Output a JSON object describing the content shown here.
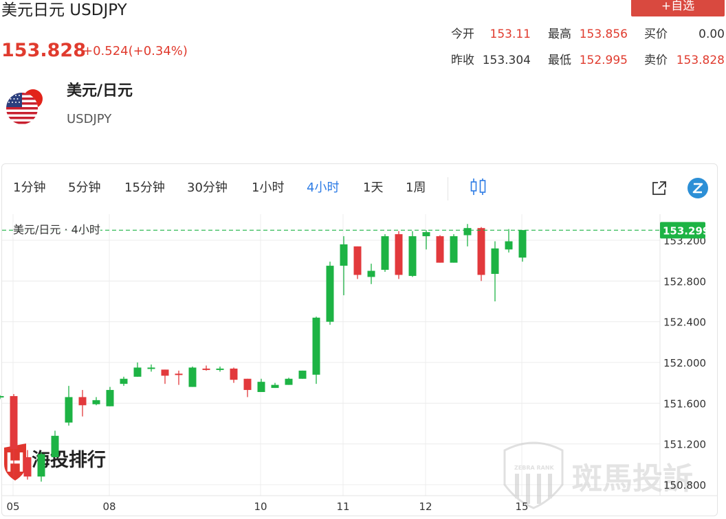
{
  "header": {
    "title": "美元日元 USDJPY",
    "add_button": "+自选",
    "price": "153.828",
    "change": "+0.524(+0.34%)"
  },
  "quote": {
    "open_label": "今开",
    "open": "153.11",
    "high_label": "最高",
    "high": "153.856",
    "bid_label": "买价",
    "bid": "0.00",
    "prev_label": "昨收",
    "prev": "153.304",
    "low_label": "最低",
    "low": "152.995",
    "ask_label": "卖价",
    "ask": "153.828"
  },
  "instrument": {
    "name": "美元/日元",
    "code": "USDJPY",
    "flag_icon": "us-flag-icon"
  },
  "periods": [
    "1分钟",
    "5分钟",
    "15分钟",
    "30分钟",
    "1小时",
    "4小时",
    "1天",
    "1周"
  ],
  "active_period": "4小时",
  "colors": {
    "up": "#1db344",
    "down": "#e2393c",
    "accent": "#2c7be5",
    "last_price": "#1db344",
    "button": "#d9493f"
  },
  "watermarks": {
    "left": "海投排行",
    "right": "斑馬投訴",
    "right_badge": "ZEBRA RANK"
  },
  "chart_data": {
    "type": "candlestick",
    "legend": "美元/日元 · 4小时",
    "last_price": "153.299",
    "y_ticks": [
      "153.200",
      "152.800",
      "152.400",
      "152.000",
      "151.600",
      "151.200",
      "150.800"
    ],
    "x_ticks": [
      "05",
      "08",
      "10",
      "11",
      "12",
      "15"
    ],
    "ylim": [
      150.73,
      153.53
    ],
    "candles": [
      {
        "o": 151.66,
        "h": 151.68,
        "l": 151.64,
        "c": 151.67
      },
      {
        "o": 151.67,
        "h": 151.69,
        "l": 150.88,
        "c": 151.15
      },
      {
        "o": 151.07,
        "h": 151.14,
        "l": 150.85,
        "c": 150.88
      },
      {
        "o": 150.88,
        "h": 151.12,
        "l": 150.83,
        "c": 151.1
      },
      {
        "o": 151.07,
        "h": 151.33,
        "l": 151.07,
        "c": 151.28
      },
      {
        "o": 151.41,
        "h": 151.77,
        "l": 151.38,
        "c": 151.66
      },
      {
        "o": 151.66,
        "h": 151.73,
        "l": 151.47,
        "c": 151.58
      },
      {
        "o": 151.59,
        "h": 151.66,
        "l": 151.58,
        "c": 151.63
      },
      {
        "o": 151.57,
        "h": 151.76,
        "l": 151.57,
        "c": 151.73
      },
      {
        "o": 151.79,
        "h": 151.86,
        "l": 151.77,
        "c": 151.84
      },
      {
        "o": 151.86,
        "h": 152.0,
        "l": 151.86,
        "c": 151.95
      },
      {
        "o": 151.95,
        "h": 151.98,
        "l": 151.91,
        "c": 151.95
      },
      {
        "o": 151.93,
        "h": 151.93,
        "l": 151.79,
        "c": 151.87
      },
      {
        "o": 151.89,
        "h": 151.92,
        "l": 151.78,
        "c": 151.88
      },
      {
        "o": 151.76,
        "h": 151.96,
        "l": 151.76,
        "c": 151.95
      },
      {
        "o": 151.94,
        "h": 151.97,
        "l": 151.92,
        "c": 151.93
      },
      {
        "o": 151.93,
        "h": 151.96,
        "l": 151.91,
        "c": 151.94
      },
      {
        "o": 151.94,
        "h": 151.95,
        "l": 151.8,
        "c": 151.83
      },
      {
        "o": 151.84,
        "h": 151.84,
        "l": 151.66,
        "c": 151.73
      },
      {
        "o": 151.71,
        "h": 151.84,
        "l": 151.71,
        "c": 151.81
      },
      {
        "o": 151.75,
        "h": 151.8,
        "l": 151.75,
        "c": 151.78
      },
      {
        "o": 151.78,
        "h": 151.85,
        "l": 151.78,
        "c": 151.84
      },
      {
        "o": 151.84,
        "h": 151.92,
        "l": 151.84,
        "c": 151.92
      },
      {
        "o": 151.88,
        "h": 152.45,
        "l": 151.79,
        "c": 152.44
      },
      {
        "o": 152.4,
        "h": 152.99,
        "l": 152.37,
        "c": 152.95
      },
      {
        "o": 152.95,
        "h": 153.24,
        "l": 152.66,
        "c": 153.16
      },
      {
        "o": 153.14,
        "h": 153.14,
        "l": 152.82,
        "c": 152.86
      },
      {
        "o": 152.84,
        "h": 152.97,
        "l": 152.77,
        "c": 152.9
      },
      {
        "o": 152.91,
        "h": 153.26,
        "l": 152.89,
        "c": 153.24
      },
      {
        "o": 153.26,
        "h": 153.29,
        "l": 152.82,
        "c": 152.86
      },
      {
        "o": 152.85,
        "h": 153.29,
        "l": 152.84,
        "c": 153.24
      },
      {
        "o": 153.24,
        "h": 153.3,
        "l": 153.11,
        "c": 153.28
      },
      {
        "o": 153.24,
        "h": 153.25,
        "l": 152.98,
        "c": 152.98
      },
      {
        "o": 152.98,
        "h": 153.26,
        "l": 152.98,
        "c": 153.24
      },
      {
        "o": 153.25,
        "h": 153.36,
        "l": 153.14,
        "c": 153.32
      },
      {
        "o": 153.32,
        "h": 153.33,
        "l": 152.8,
        "c": 152.86
      },
      {
        "o": 152.87,
        "h": 153.19,
        "l": 152.6,
        "c": 153.12
      },
      {
        "o": 153.11,
        "h": 153.31,
        "l": 153.08,
        "c": 153.19
      },
      {
        "o": 153.03,
        "h": 153.3,
        "l": 152.99,
        "c": 153.3
      }
    ]
  }
}
